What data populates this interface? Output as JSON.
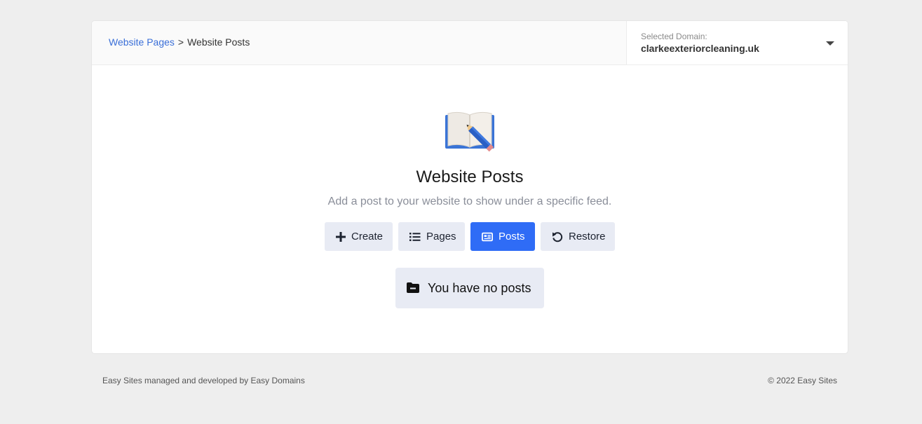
{
  "breadcrumb": {
    "parent": "Website Pages",
    "separator": ">",
    "current": "Website Posts"
  },
  "domain_selector": {
    "label": "Selected Domain:",
    "value": "clarkeexteriorcleaning.uk",
    "icon": "caret-down-icon"
  },
  "hero": {
    "icon": "book-pencil-icon",
    "title": "Website Posts",
    "subtitle": "Add a post to your website to show under a specific feed."
  },
  "actions": {
    "create_label": "Create",
    "pages_label": "Pages",
    "posts_label": "Posts",
    "restore_label": "Restore",
    "active": "Posts"
  },
  "empty_state": {
    "icon": "folder-minus-icon",
    "message": "You have no posts"
  },
  "footer": {
    "left": "Easy Sites managed and developed by Easy Domains",
    "right": "© 2022 Easy Sites"
  },
  "colors": {
    "page_bg": "#eeeeee",
    "link": "#3a6fd8",
    "primary": "#2f6cf6",
    "button_bg": "#e8ebf4",
    "subtitle": "#8a8e99"
  }
}
